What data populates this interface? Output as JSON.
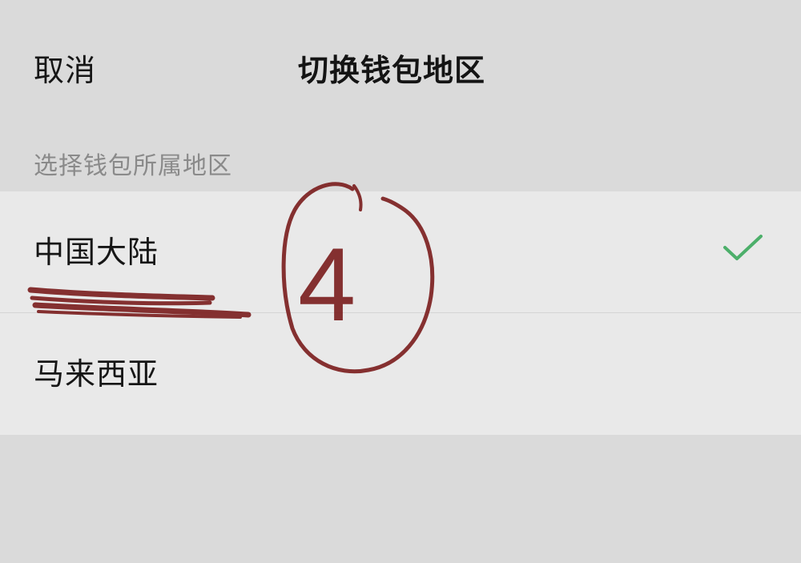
{
  "header": {
    "cancel_label": "取消",
    "title": "切换钱包地区"
  },
  "section": {
    "label": "选择钱包所属地区"
  },
  "regions": [
    {
      "label": "中国大陆",
      "selected": true
    },
    {
      "label": "马来西亚",
      "selected": false
    }
  ],
  "colors": {
    "background": "#dadada",
    "list_background": "#e9e9e9",
    "check": "#4caf6a",
    "annotation_ink": "#7a1c1c"
  },
  "annotation": {
    "text": "4"
  }
}
